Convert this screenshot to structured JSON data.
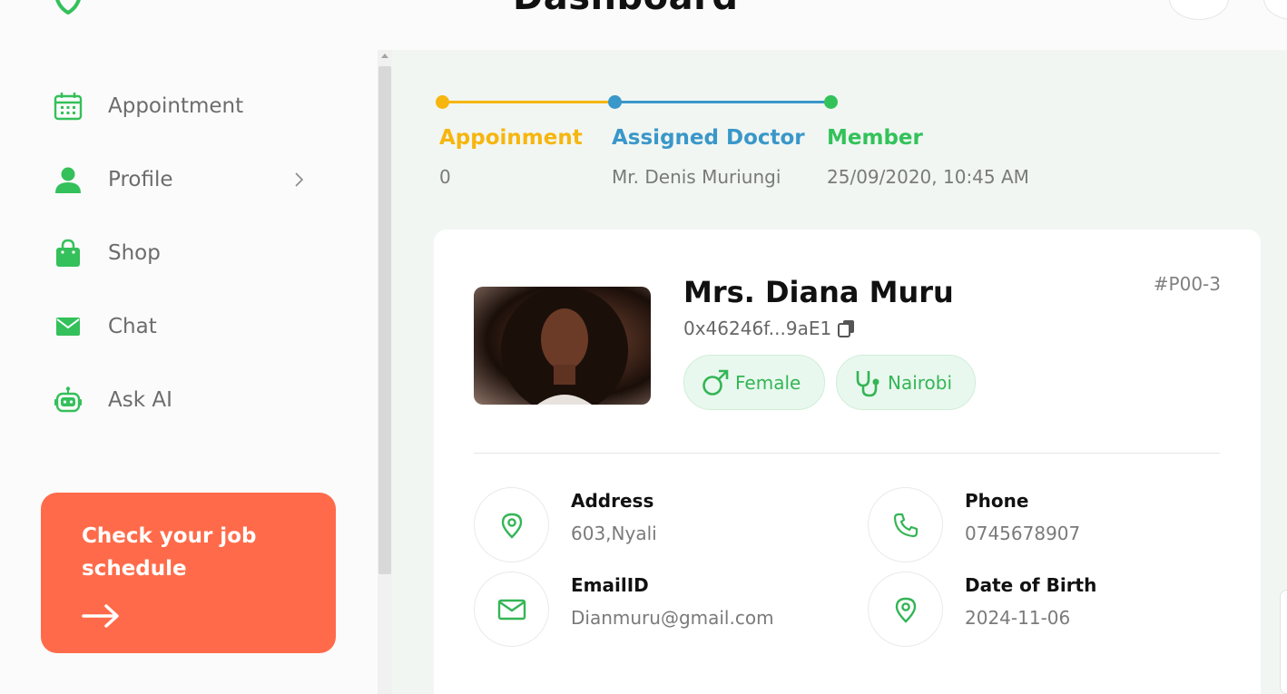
{
  "colors": {
    "brand_green": "#34c05a",
    "appointment_yellow": "#f6b60f",
    "doctor_blue": "#3a97c9",
    "member_green": "#33c25a",
    "promo_orange": "#ff6b4a"
  },
  "header": {
    "title": "Dashboard",
    "logo_icon": "shield-logo-icon",
    "menu_icon": "hamburger-icon"
  },
  "sidebar": {
    "items": [
      {
        "label": "Appointment",
        "icon": "calendar-icon"
      },
      {
        "label": "Profile",
        "icon": "user-icon",
        "has_submenu": true
      },
      {
        "label": "Shop",
        "icon": "shopping-bag-icon"
      },
      {
        "label": "Chat",
        "icon": "mail-icon"
      },
      {
        "label": "Ask AI",
        "icon": "robot-icon"
      }
    ],
    "promo": {
      "text": "Check your job schedule",
      "icon": "arrow-right-icon"
    }
  },
  "stats": [
    {
      "title": "Appoinment",
      "value": "0"
    },
    {
      "title": "Assigned Doctor",
      "value": "Mr. Denis Muriungi"
    },
    {
      "title": "Member",
      "value": "25/09/2020, 10:45 AM"
    }
  ],
  "profile": {
    "name": "Mrs. Diana Muru",
    "wallet": "0x46246f...9aE1",
    "patient_id": "#P00-3",
    "tags": [
      {
        "label": "Female",
        "icon": "male-gender-icon"
      },
      {
        "label": "Nairobi",
        "icon": "stethoscope-icon"
      }
    ],
    "details": [
      {
        "label": "Address",
        "value": "603,Nyali",
        "icon": "location-pin-icon"
      },
      {
        "label": "Phone",
        "value": "0745678907",
        "icon": "phone-icon"
      },
      {
        "label": "EmailID",
        "value": "Dianmuru@gmail.com",
        "icon": "mail-icon"
      },
      {
        "label": "Date of Birth",
        "value": "2024-11-06",
        "icon": "location-pin-icon"
      }
    ]
  }
}
